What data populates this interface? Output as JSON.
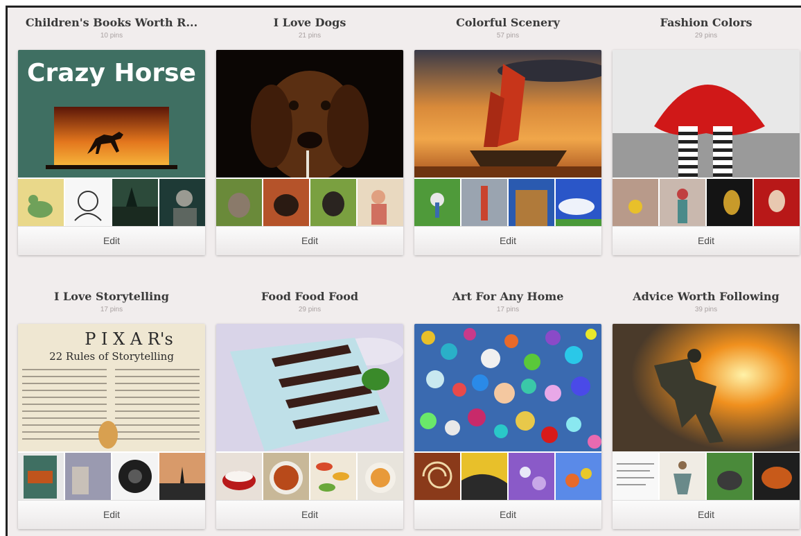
{
  "boards": [
    {
      "title": "Children's Books Worth R...",
      "count": "10 pins",
      "edit_label": "Edit",
      "cover": "crazy-horse-book-cover",
      "cover_text": "Crazy Horse",
      "thumbs": [
        "dinosaur-book",
        "sketch-drawing",
        "forest-scene",
        "portrait-photo"
      ]
    },
    {
      "title": "I Love Dogs",
      "count": "21 pins",
      "edit_label": "Edit",
      "cover": "dog-photo",
      "thumbs": [
        "kitten-photo",
        "puppy-photo",
        "pug-photo",
        "toddler-photo"
      ]
    },
    {
      "title": "Colorful Scenery",
      "count": "57 pins",
      "edit_label": "Edit",
      "cover": "sailboat-sunset",
      "thumbs": [
        "green-landscape",
        "lighthouse-bridge",
        "building-facade",
        "blue-sky"
      ]
    },
    {
      "title": "Fashion Colors",
      "count": "29 pins",
      "edit_label": "Edit",
      "cover": "red-dress-striped-tights",
      "thumbs": [
        "flower-hands",
        "woman-outdoors",
        "dark-portrait",
        "red-hood"
      ]
    },
    {
      "title": "I Love Storytelling",
      "count": "17 pins",
      "edit_label": "Edit",
      "cover": "pixar-rules-poster",
      "cover_text_1": "P I X A R's",
      "cover_text_2": "22 Rules of Storytelling",
      "thumbs": [
        "crazy-horse-book",
        "interior-photo",
        "circular-badge",
        "silhouette-sunset"
      ]
    },
    {
      "title": "Food Food Food",
      "count": "29 pins",
      "edit_label": "Edit",
      "cover": "layered-cake",
      "thumbs": [
        "red-velvet-dessert",
        "soup-bowl",
        "salads-plates",
        "pasta-dish"
      ]
    },
    {
      "title": "Art For Any Home",
      "count": "17 pins",
      "edit_label": "Edit",
      "cover": "colorful-mosaic",
      "thumbs": [
        "spiral-shell",
        "yellow-painting",
        "purple-painting",
        "floral-painting"
      ]
    },
    {
      "title": "Advice Worth Following",
      "count": "39 pins",
      "edit_label": "Edit",
      "cover": "fire-figure",
      "thumbs": [
        "text-article",
        "yoga-pose",
        "animal-photo",
        "food-platter"
      ]
    }
  ],
  "colors": {
    "background": "#f1eded",
    "title": "#3a3a3a",
    "count": "#a9a1a1",
    "edit_text": "#4a4a4a"
  }
}
